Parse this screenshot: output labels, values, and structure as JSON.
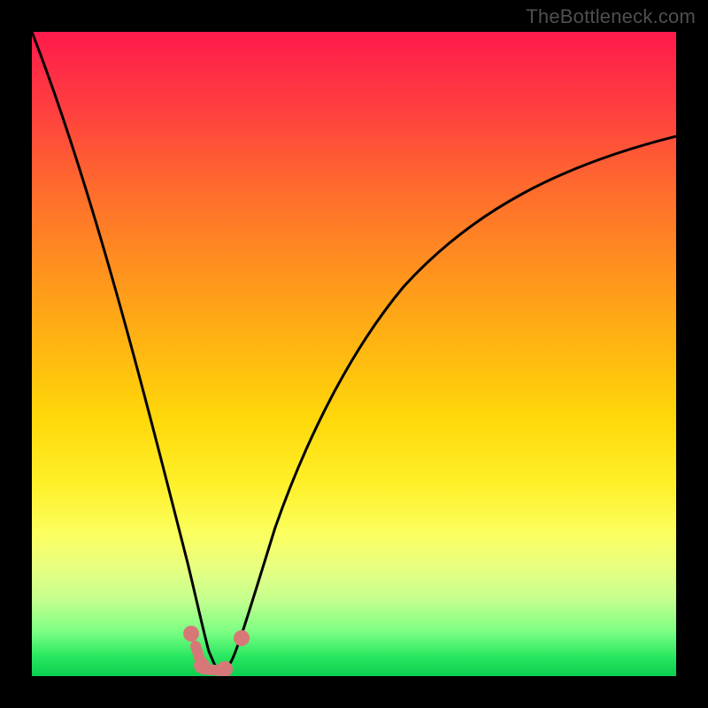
{
  "watermark": "TheBottleneck.com",
  "colors": {
    "frame": "#000000",
    "curve": "#000000",
    "marker": "#d77878",
    "gradient_top": "#ff1a4b",
    "gradient_bottom": "#0ccf4f"
  },
  "chart_data": {
    "type": "line",
    "title": "",
    "xlabel": "",
    "ylabel": "",
    "xlim": [
      0,
      100
    ],
    "ylim": [
      0,
      100
    ],
    "x": [
      0,
      5,
      10,
      15,
      20,
      23,
      25,
      27,
      28.5,
      30,
      33,
      36,
      40,
      45,
      50,
      55,
      60,
      65,
      70,
      75,
      80,
      85,
      90,
      95,
      100
    ],
    "values": [
      100,
      82,
      63,
      45,
      26,
      12,
      5,
      1,
      0,
      0,
      6,
      16,
      27,
      38,
      47,
      54,
      60,
      65,
      69,
      72.5,
      75.5,
      78,
      80,
      82,
      83.5
    ],
    "annotations": [
      {
        "label": "marker",
        "x": 24.5,
        "y": 6
      },
      {
        "label": "marker",
        "x": 26,
        "y": 1
      },
      {
        "label": "marker",
        "x": 28,
        "y": 0
      },
      {
        "label": "marker",
        "x": 30,
        "y": 0
      },
      {
        "label": "marker",
        "x": 32.5,
        "y": 5
      }
    ]
  }
}
